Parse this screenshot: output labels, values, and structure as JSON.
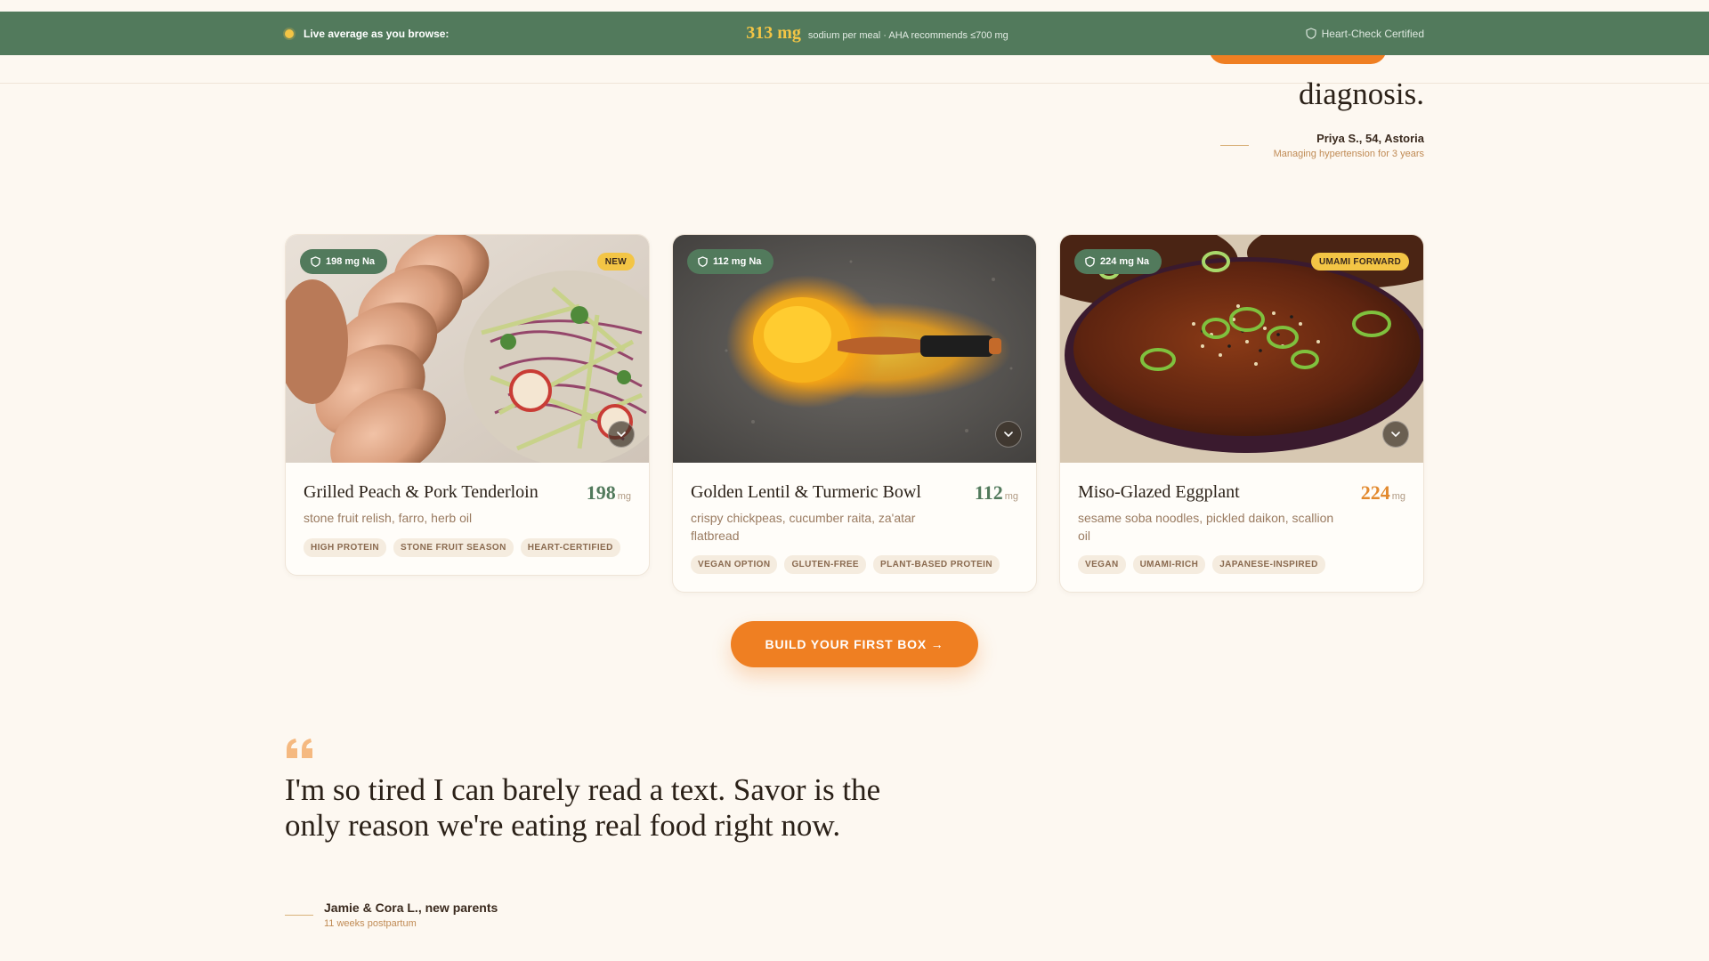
{
  "colors": {
    "brand_green": "#527a5c",
    "accent_orange": "#ef7f22",
    "accent_yellow": "#f3c545",
    "background": "#fdf8f1"
  },
  "topbar": {
    "live_label": "Live average as you browse:",
    "average_value": "313 mg",
    "average_caption": "sodium per meal · AHA recommends ≤700 mg",
    "certified_label": "Heart-Check Certified",
    "certified_icon": "shield-icon"
  },
  "testimonial_top": {
    "quote_tail": "diagnosis.",
    "author": "Priya S., 54, Astoria",
    "meta": "Managing hypertension for 3 years"
  },
  "cards": [
    {
      "sodium_badge": "198 mg Na",
      "tag_badge": "NEW",
      "title": "Grilled Peach & Pork Tenderloin",
      "sodium_value": "198",
      "sodium_unit": "mg",
      "subtitle": "stone fruit relish, farro, herb oil",
      "tags": [
        "HIGH PROTEIN",
        "STONE FRUIT SEASON",
        "HEART-CERTIFIED"
      ]
    },
    {
      "sodium_badge": "112 mg Na",
      "title": "Golden Lentil & Turmeric Bowl",
      "sodium_value": "112",
      "sodium_unit": "mg",
      "subtitle": "crispy chickpeas, cucumber raita, za'atar flatbread",
      "tags": [
        "VEGAN OPTION",
        "GLUTEN-FREE",
        "PLANT-BASED PROTEIN"
      ]
    },
    {
      "sodium_badge": "224 mg Na",
      "tag_badge": "UMAMI FORWARD",
      "title": "Miso-Glazed Eggplant",
      "sodium_value": "224",
      "sodium_unit": "mg",
      "subtitle": "sesame soba noodles, pickled daikon, scallion oil",
      "tags": [
        "VEGAN",
        "UMAMI-RICH",
        "JAPANESE-INSPIRED"
      ]
    }
  ],
  "cta": {
    "label": "BUILD YOUR FIRST BOX →"
  },
  "testimonial_bottom": {
    "quote": "I'm so tired I can barely read a text. Savor is the only reason we're eating real food right now.",
    "author": "Jamie & Cora L., new parents",
    "meta": "11 weeks postpartum"
  }
}
